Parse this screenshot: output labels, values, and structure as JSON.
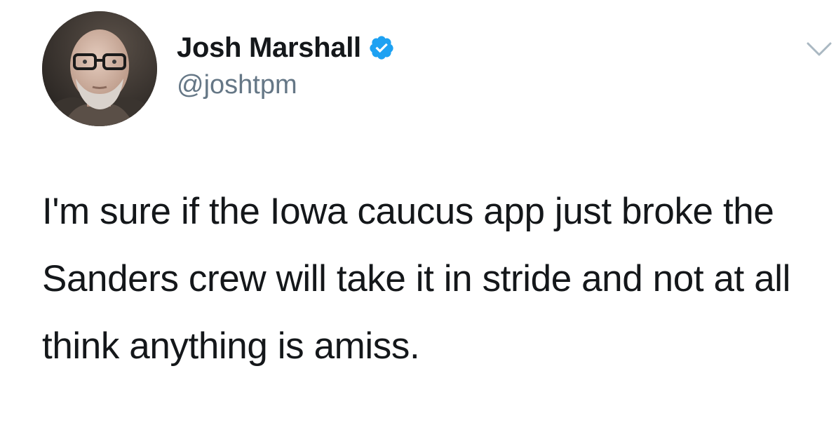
{
  "author": {
    "display_name": "Josh Marshall",
    "handle": "@joshtpm",
    "verified": true,
    "avatar_icon": "profile-photo"
  },
  "header": {
    "menu_icon": "chevron-down-icon"
  },
  "tweet": {
    "text": "I'm sure if the Iowa caucus app just broke the Sanders crew will take it in stride and not at all think anything is amiss."
  },
  "colors": {
    "text": "#14171a",
    "secondary": "#657786",
    "verified": "#1da1f2",
    "chevron": "#aab8c2"
  }
}
